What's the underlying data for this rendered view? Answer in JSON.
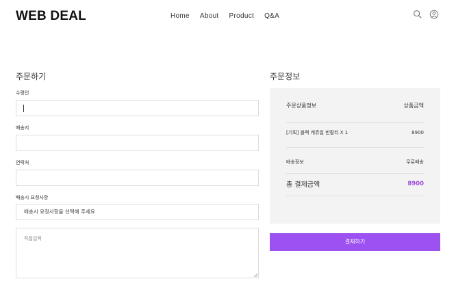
{
  "brand": {
    "logo": "WEB DEAL"
  },
  "nav": {
    "items": [
      "Home",
      "About",
      "Product",
      "Q&A"
    ]
  },
  "icons": {
    "search": "search-icon",
    "user": "user-icon"
  },
  "order_form": {
    "title": "주문하기",
    "recipient_label": "수령인",
    "recipient_value": "",
    "address_label": "배송지",
    "address_value": "",
    "contact_label": "연락처",
    "contact_value": "",
    "request_label": "배송시 요청사항",
    "request_select_value": "배송시 요청사항을 선택해 주세요",
    "custom_request_placeholder": "직접입력"
  },
  "order_info": {
    "title": "주문정보",
    "product_info_label": "주문상품정보",
    "product_amount_label": "상품금액",
    "item_name": "[기획] 블랙 캐쥬얼 반팔티 X 1",
    "item_price": "8900",
    "shipping_label": "배송정보",
    "shipping_value": "무료배송",
    "total_label": "총 결제금액",
    "total_value": "8900"
  },
  "actions": {
    "pay_label": "결제하기"
  },
  "colors": {
    "accent": "#9c51f0",
    "panel_bg": "#f3f3f3",
    "total_price": "#9d4ddb"
  }
}
